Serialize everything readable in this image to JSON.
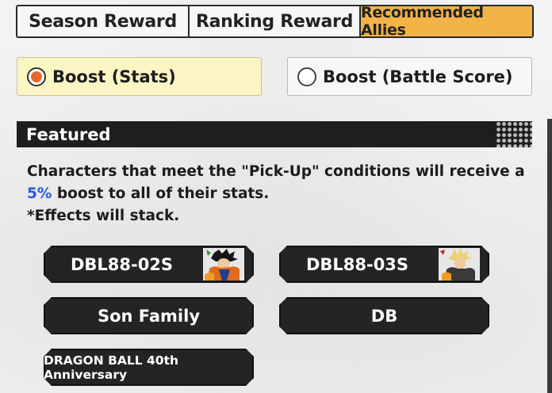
{
  "tabs": [
    {
      "label": "Season Reward",
      "active": false
    },
    {
      "label": "Ranking Reward",
      "active": false
    },
    {
      "label": "Recommended Allies",
      "active": true
    }
  ],
  "boost_options": [
    {
      "label": "Boost (Stats)",
      "selected": true
    },
    {
      "label": "Boost (Battle Score)",
      "selected": false
    }
  ],
  "featured": {
    "title": "Featured",
    "desc_part1": "Characters that meet the \"Pick-Up\" conditions will receive a ",
    "desc_percent": "5%",
    "desc_part2": " boost to all of their stats.",
    "desc_note": "*Effects will stack."
  },
  "conditions": [
    {
      "label": "DBL88-02S",
      "icon": "character-portrait-goku"
    },
    {
      "label": "DBL88-03S",
      "icon": "character-portrait-gohan"
    },
    {
      "label": "Son Family"
    },
    {
      "label": "DB"
    },
    {
      "label": "DRAGON BALL 40th Anniversary"
    }
  ],
  "colors": {
    "active_tab": "#f3b347",
    "selected_option_bg": "#fbf4c3",
    "radio_selected": "#e9692c",
    "highlight": "#2a5bd8",
    "chip_bg": "#242424"
  }
}
